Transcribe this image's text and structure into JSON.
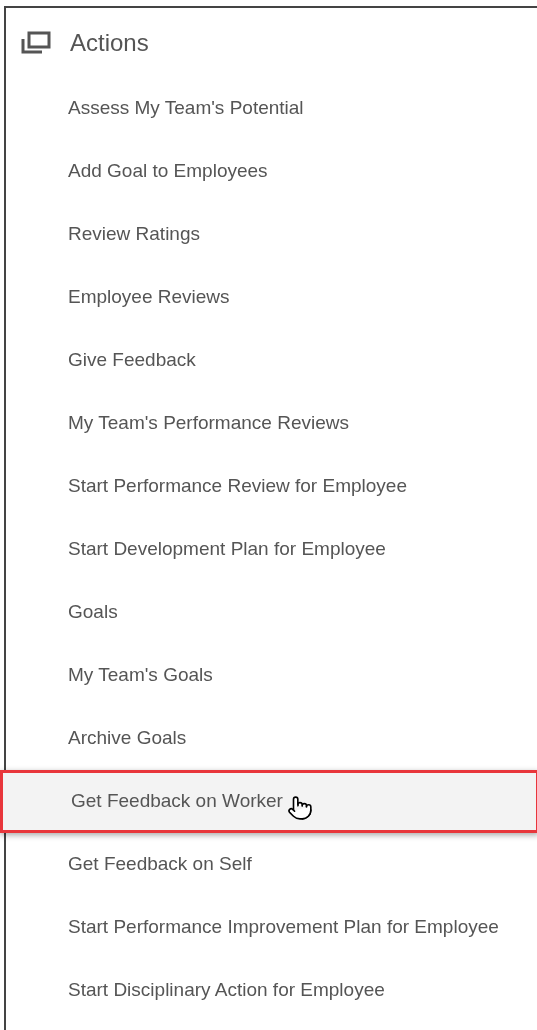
{
  "panel": {
    "title": "Actions"
  },
  "items": [
    {
      "label": "Assess My Team's Potential",
      "selected": false
    },
    {
      "label": "Add Goal to Employees",
      "selected": false
    },
    {
      "label": "Review Ratings",
      "selected": false
    },
    {
      "label": "Employee Reviews",
      "selected": false
    },
    {
      "label": "Give Feedback",
      "selected": false
    },
    {
      "label": "My Team's Performance Reviews",
      "selected": false
    },
    {
      "label": "Start Performance Review for Employee",
      "selected": false
    },
    {
      "label": "Start Development Plan for Employee",
      "selected": false
    },
    {
      "label": "Goals",
      "selected": false
    },
    {
      "label": "My Team's Goals",
      "selected": false
    },
    {
      "label": "Archive Goals",
      "selected": false
    },
    {
      "label": "Get Feedback on Worker",
      "selected": true
    },
    {
      "label": "Get Feedback on Self",
      "selected": false
    },
    {
      "label": "Start Performance Improvement Plan for Employee",
      "selected": false
    },
    {
      "label": "Start Disciplinary Action for Employee",
      "selected": false
    }
  ]
}
